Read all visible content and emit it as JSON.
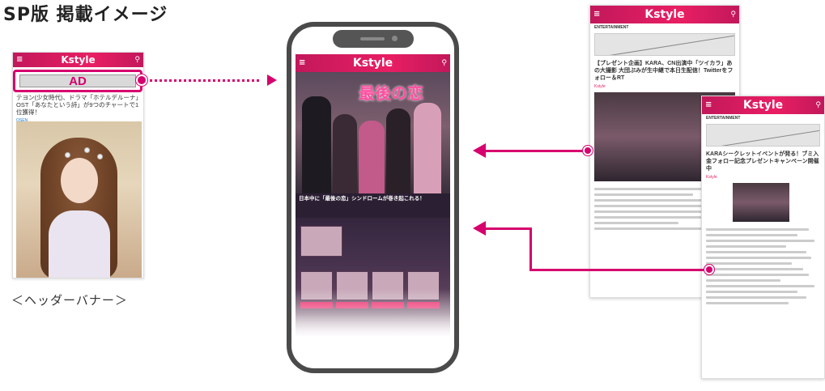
{
  "page": {
    "title": "SP版 掲載イメージ",
    "caption": "＜ヘッダーバナー＞"
  },
  "brand": {
    "logo": "Kstyle",
    "accent_color": "#d6006e"
  },
  "left_screen": {
    "ad_label": "AD",
    "article_text": "テヨン(少女時代)、ドラマ「ホテルデルーナ」OST「あなたという詩」が9つのチャートで1位獲得！",
    "article_meta": "OSEN"
  },
  "center_screen": {
    "hero_title": "最後の恋",
    "hero_caption": "日本中に「最後の恋」シンドロームが巻き起これる！"
  },
  "right_screen_1": {
    "section": "ENTERTAINMENT",
    "headline": "【プレゼント企画】KARA、CN出演中「ツイカラ」あの大撮影 大団ぷみが生中継で本日生配信！Twitterをフォロー＆RT",
    "brand": "Kstyle"
  },
  "right_screen_2": {
    "section": "ENTERTAINMENT",
    "headline": "KARAシークレットイベントが発る！ブミ入金フォロー記念プレゼントキャンペーン開催中",
    "brand": "Kstyle"
  },
  "icons": {
    "menu": "hamburger-icon",
    "search": "search-icon"
  }
}
